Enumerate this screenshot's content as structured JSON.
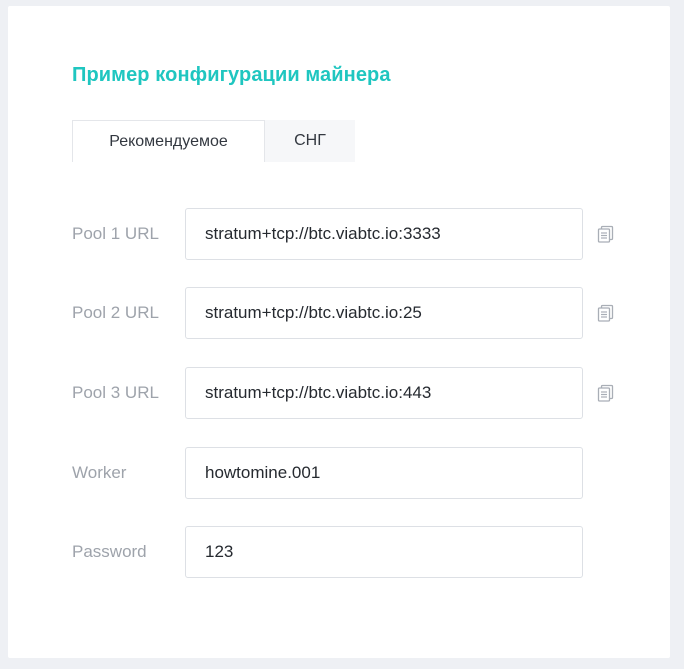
{
  "section": {
    "title": "Пример конфигурации майнера"
  },
  "tabs": [
    {
      "label": "Рекомендуемое",
      "active": true
    },
    {
      "label": "СНГ",
      "active": false
    }
  ],
  "fields": [
    {
      "label": "Pool 1 URL",
      "value": "stratum+tcp://btc.viabtc.io:3333",
      "copy_icon": "copy-icon"
    },
    {
      "label": "Pool 2 URL",
      "value": "stratum+tcp://btc.viabtc.io:25",
      "copy_icon": "copy-icon"
    },
    {
      "label": "Pool 3 URL",
      "value": "stratum+tcp://btc.viabtc.io:443",
      "copy_icon": "copy-icon"
    },
    {
      "label": "Worker",
      "value": "howtomine.001"
    },
    {
      "label": "Password",
      "value": "123"
    }
  ],
  "colors": {
    "accent": "#1fc6c0",
    "label": "#9ea3ab",
    "text": "#262a30",
    "border": "#dde0e5",
    "background": "#eef0f4"
  }
}
